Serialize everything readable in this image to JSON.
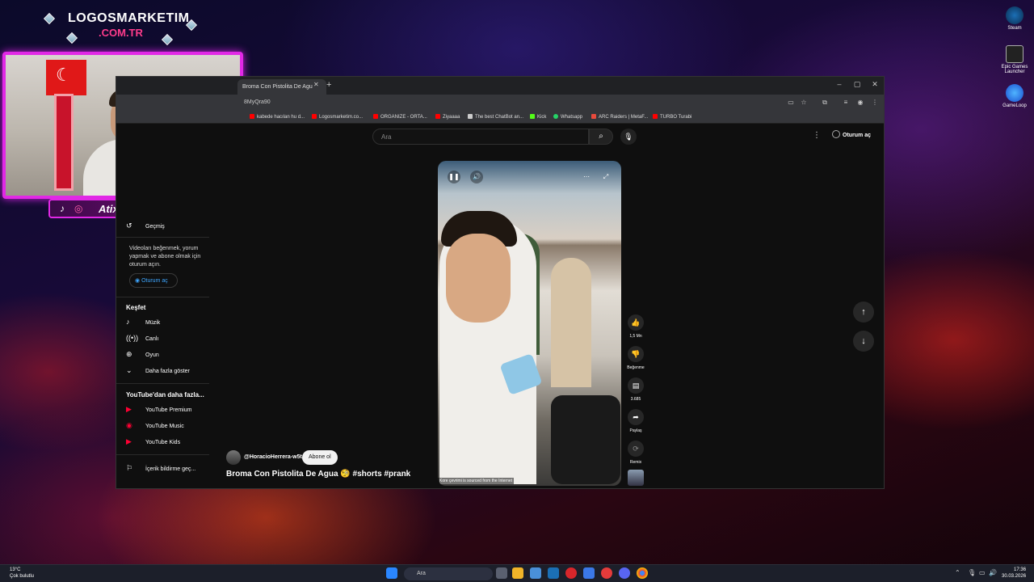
{
  "overlay": {
    "brand_line1": "LOGOSMARKETIM",
    "brand_line2": ".COM.TR",
    "streamer_name": "Atixlive",
    "social_icons": [
      "tiktok-icon",
      "instagram-icon"
    ]
  },
  "desktop_icons": [
    {
      "label": "Steam",
      "icon": "steam-icon"
    },
    {
      "label": "Epic Games Launcher",
      "icon": "epic-games-icon"
    },
    {
      "label": "GameLoop",
      "icon": "gameloop-icon"
    }
  ],
  "browser": {
    "tab_title": "Broma Con Pistolita De Agu",
    "url": "8MyQra90",
    "window_controls": [
      "–",
      "▢",
      "✕"
    ],
    "bookmarks": [
      {
        "label": "kabede hacılan hu d...",
        "color": "#ff0000"
      },
      {
        "label": "Logosmarketim.co...",
        "color": "#ff0000"
      },
      {
        "label": "ORGANIZE - ORTA...",
        "color": "#ff0000"
      },
      {
        "label": "Ziyaaaa",
        "color": "#ff0000"
      },
      {
        "label": "The best ChatBot an...",
        "color": "#cccccc"
      },
      {
        "label": "Kick",
        "color": "#53fc18"
      },
      {
        "label": "Whatsapp",
        "color": "#25d366"
      },
      {
        "label": "ARC Raiders | MetaF...",
        "color": "#e84a3c"
      },
      {
        "label": "TURBO Turabi",
        "color": "#ff0000"
      }
    ]
  },
  "youtube": {
    "search_placeholder": "Ara",
    "signin_label": "Oturum aç",
    "sidebar": {
      "history_label": "Geçmiş",
      "signin_prompt": "Videoları beğenmek, yorum yapmak ve abone olmak için oturum açın.",
      "signin_button": "Oturum aç",
      "explore_heading": "Keşfet",
      "explore_items": [
        "Müzik",
        "Canlı",
        "Oyun",
        "Daha fazla göster"
      ],
      "more_heading": "YouTube'dan daha fazla...",
      "more_items": [
        "YouTube Premium",
        "YouTube Music",
        "YouTube Kids"
      ],
      "report_label": "İçerik bildirme geç..."
    },
    "short": {
      "caption": "Kore çevrimi is sourced from the Internet",
      "channel_handle": "@HoracioHerrera-w5t",
      "subscribe_label": "Abone ol",
      "title": "Broma Con Pistolita De Agua 🧐 #shorts #prank",
      "actions": {
        "like_count": "1,5 Mn",
        "dislike_label": "Beğenme",
        "comment_count": "3.685",
        "share_label": "Paylaş",
        "remix_label": "Remix"
      }
    }
  },
  "taskbar": {
    "weather_temp": "13°C",
    "weather_desc": "Çok bulutlu",
    "search_label": "Ara",
    "time": "17:36",
    "date": "30.03.2026"
  }
}
